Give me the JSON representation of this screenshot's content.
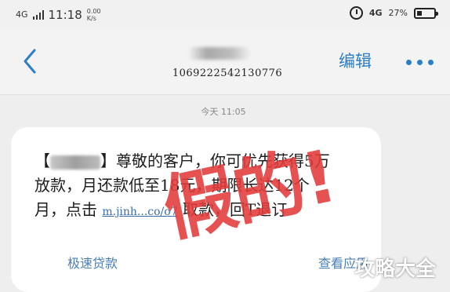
{
  "status_bar": {
    "network_left": "4G",
    "time": "11:18",
    "speed_value": "0.00",
    "speed_unit": "K/s",
    "network_right": "4G",
    "battery_percent": "27%"
  },
  "header": {
    "contact_number": "1069222542130776",
    "edit_label": "编辑"
  },
  "conversation": {
    "timestamp": "今天 11:05",
    "message": {
      "bracket_open": "【",
      "bracket_close": "】",
      "line1": "尊敬的客户，你可优先获得5万",
      "line2": "放款，月还款低至18元，期限长达12个",
      "line3_prefix": "月，点击",
      "link": "m.jinh...co/o7",
      "line3_suffix": "取款，回T退订"
    },
    "actions": {
      "left_label": "极速贷款",
      "right_label": "查看应用"
    }
  },
  "overlay": {
    "stamp_text": "假的!",
    "watermark_text": "攻略大全",
    "stamp_color": "#e33a3a"
  },
  "colors": {
    "accent": "#2e7ec4",
    "link": "#3a6ea5"
  }
}
